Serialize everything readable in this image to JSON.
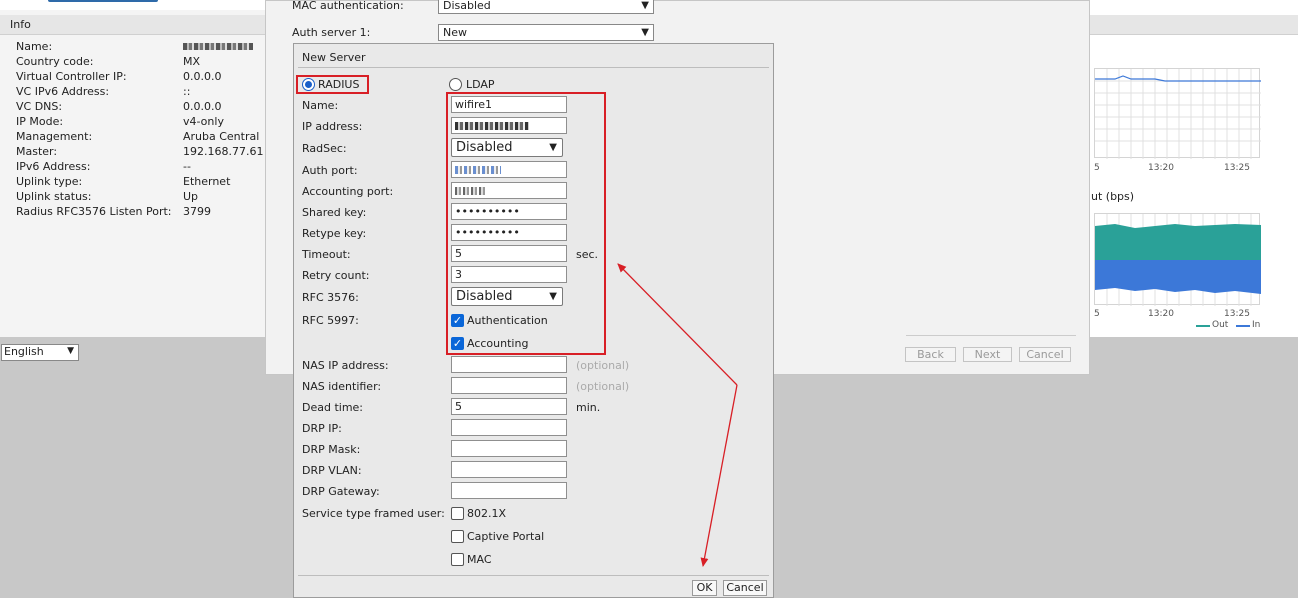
{
  "info_panel": {
    "title": "Info",
    "rows": [
      {
        "label": "Name:",
        "value": ""
      },
      {
        "label": "Country code:",
        "value": "MX"
      },
      {
        "label": "Virtual Controller IP:",
        "value": "0.0.0.0"
      },
      {
        "label": "VC IPv6 Address:",
        "value": "::"
      },
      {
        "label": "VC DNS:",
        "value": "0.0.0.0"
      },
      {
        "label": "IP Mode:",
        "value": "v4-only"
      },
      {
        "label": "Management:",
        "value": "Aruba Central"
      },
      {
        "label": "Master:",
        "value": "192.168.77.61"
      },
      {
        "label": "IPv6 Address:",
        "value": "--"
      },
      {
        "label": "Uplink type:",
        "value": "Ethernet"
      },
      {
        "label": "Uplink status:",
        "value": "Up"
      },
      {
        "label": "Radius RFC3576 Listen Port:",
        "value": "3799"
      }
    ]
  },
  "language": {
    "selected": "English"
  },
  "wizard": {
    "mac_auth_label": "MAC authentication:",
    "mac_auth_value": "Disabled",
    "auth_server_label": "Auth server 1:",
    "auth_server_value": "New",
    "back_label": "Back",
    "next_label": "Next",
    "cancel_label": "Cancel"
  },
  "modal": {
    "title": "New Server",
    "type_radius": "RADIUS",
    "type_ldap": "LDAP",
    "selected_type": "RADIUS",
    "fields": {
      "name": {
        "label": "Name:",
        "value": "wifire1"
      },
      "ip_address": {
        "label": "IP address:",
        "value": ""
      },
      "radsec": {
        "label": "RadSec:",
        "value": "Disabled"
      },
      "auth_port": {
        "label": "Auth port:",
        "value": ""
      },
      "accounting_port": {
        "label": "Accounting port:",
        "value": ""
      },
      "shared_key": {
        "label": "Shared key:",
        "value": "••••••••••"
      },
      "retype_key": {
        "label": "Retype key:",
        "value": "••••••••••"
      },
      "timeout": {
        "label": "Timeout:",
        "value": "5",
        "unit": "sec."
      },
      "retry_count": {
        "label": "Retry count:",
        "value": "3"
      },
      "rfc3576": {
        "label": "RFC 3576:",
        "value": "Disabled"
      },
      "rfc5997": {
        "label": "RFC 5997:",
        "authentication": "Authentication",
        "accounting": "Accounting",
        "authentication_checked": true,
        "accounting_checked": true
      },
      "nas_ip": {
        "label": "NAS IP address:",
        "value": "",
        "hint": "(optional)"
      },
      "nas_identifier": {
        "label": "NAS identifier:",
        "value": "",
        "hint": "(optional)"
      },
      "dead_time": {
        "label": "Dead time:",
        "value": "5",
        "unit": "min."
      },
      "drp_ip": {
        "label": "DRP IP:",
        "value": ""
      },
      "drp_mask": {
        "label": "DRP Mask:",
        "value": ""
      },
      "drp_vlan": {
        "label": "DRP VLAN:",
        "value": ""
      },
      "drp_gateway": {
        "label": "DRP Gateway:",
        "value": ""
      },
      "service_type": {
        "label": "Service type framed user:",
        "opt_8021x": "802.1X",
        "opt_captive": "Captive Portal",
        "opt_mac": "MAC"
      }
    },
    "ok_label": "OK",
    "cancel_label": "Cancel"
  },
  "right_panel": {
    "chart1_ticks": [
      "5",
      "13:20",
      "13:25"
    ],
    "chart2_title": "ut  (bps)",
    "chart2_ticks": [
      "5",
      "13:20",
      "13:25"
    ],
    "legend_out": "Out",
    "legend_in": "In"
  },
  "colors": {
    "annotation_red": "#d81f26",
    "chart_out": "#2aa198",
    "chart_in": "#3c78d8"
  }
}
